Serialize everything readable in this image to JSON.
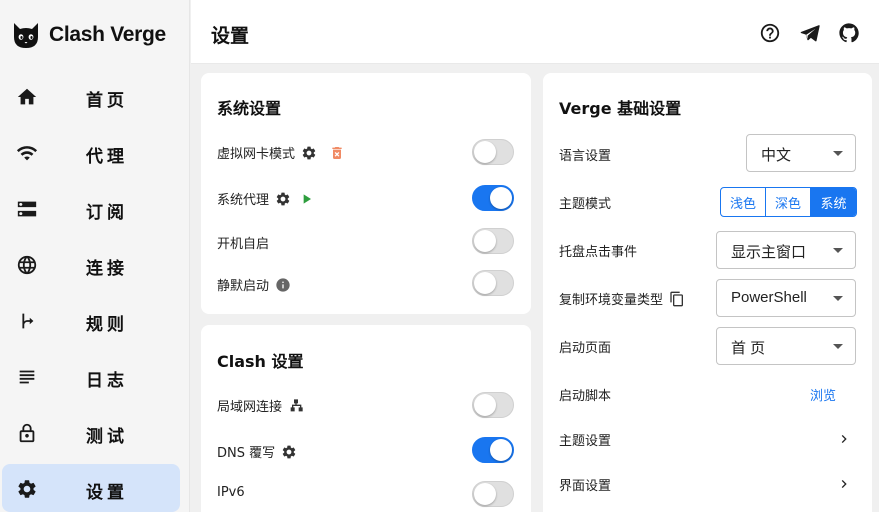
{
  "app": {
    "name": "Clash Verge"
  },
  "sidebar": {
    "items": [
      {
        "label": "首页",
        "icon": "home-icon"
      },
      {
        "label": "代理",
        "icon": "wifi-icon"
      },
      {
        "label": "订阅",
        "icon": "storage-icon"
      },
      {
        "label": "连接",
        "icon": "globe-icon"
      },
      {
        "label": "规则",
        "icon": "fork-arrow-icon"
      },
      {
        "label": "日志",
        "icon": "lines-icon"
      },
      {
        "label": "测试",
        "icon": "lock-icon"
      },
      {
        "label": "设置",
        "icon": "gear-icon",
        "active": true
      }
    ]
  },
  "header": {
    "title": "设置"
  },
  "system": {
    "title": "系统设置",
    "rows": [
      {
        "label": "虚拟网卡模式",
        "on": false
      },
      {
        "label": "系统代理",
        "on": true
      },
      {
        "label": "开机自启",
        "on": false
      },
      {
        "label": "静默启动",
        "on": false
      }
    ]
  },
  "clash": {
    "title": "Clash 设置",
    "rows": [
      {
        "label": "局域网连接",
        "on": false
      },
      {
        "label": "DNS 覆写",
        "on": true
      },
      {
        "label": "IPv6",
        "on": false
      }
    ]
  },
  "verge": {
    "title": "Verge 基础设置",
    "language": {
      "label": "语言设置",
      "value": "中文"
    },
    "theme_mode": {
      "label": "主题模式",
      "options": [
        "浅色",
        "深色",
        "系统"
      ],
      "selected": "系统"
    },
    "tray_event": {
      "label": "托盘点击事件",
      "value": "显示主窗口"
    },
    "env_type": {
      "label": "复制环境变量类型",
      "value": "PowerShell"
    },
    "start_page": {
      "label": "启动页面",
      "value": "首 页"
    },
    "start_script": {
      "label": "启动脚本",
      "action": "浏览"
    },
    "theme_settings": {
      "label": "主题设置"
    },
    "ui_settings": {
      "label": "界面设置"
    }
  },
  "colors": {
    "accent": "#1976f0",
    "active_nav": "#d5e4fa",
    "play": "#2e9e3e",
    "delete": "#f08a64"
  }
}
